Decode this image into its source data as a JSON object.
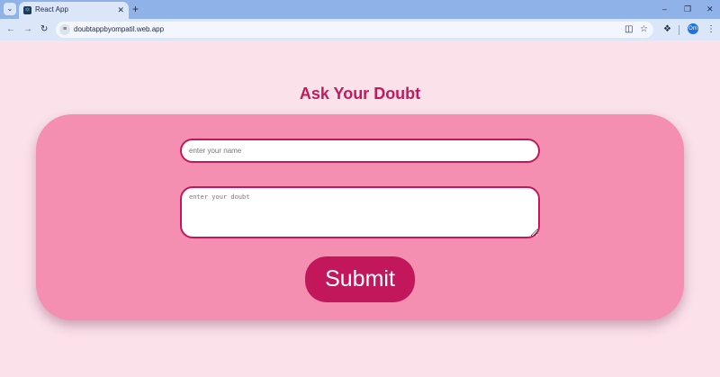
{
  "browser": {
    "tab_title": "React App",
    "url": "doubtappbyompatil.web.app",
    "new_tab_label": "+",
    "profile_initials": "Om"
  },
  "page": {
    "heading": "Ask Your Doubt",
    "name_placeholder": "enter your name",
    "doubt_placeholder": "enter your doubt",
    "submit_label": "Submit"
  },
  "colors": {
    "page_background": "#fae1ea",
    "card_background": "#f48fb1",
    "accent": "#c2185b"
  },
  "icons": {
    "tab_search": "chevron-down-icon",
    "favicon": "react-icon",
    "tab_close": "close-icon",
    "minimize": "minimize-icon",
    "restore": "restore-icon",
    "close_window": "close-icon",
    "back": "arrow-left-icon",
    "forward": "arrow-right-icon",
    "reload": "reload-icon",
    "site_info": "tune-icon",
    "install": "install-app-icon",
    "bookmark": "star-icon",
    "extensions": "puzzle-icon",
    "menu": "kebab-menu-icon"
  }
}
